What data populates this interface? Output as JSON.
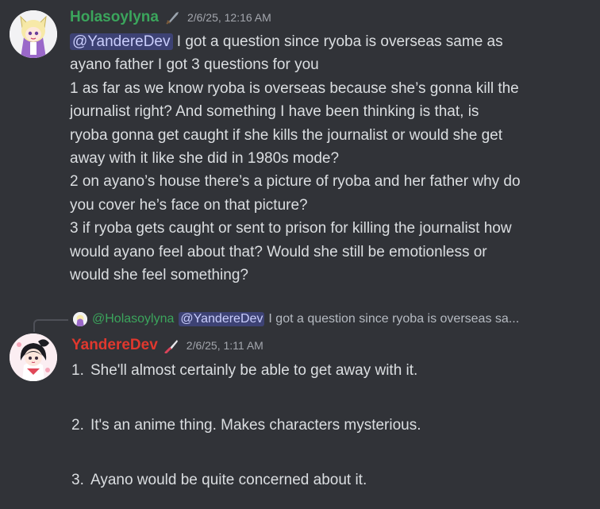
{
  "message1": {
    "username": "Holasoylyna",
    "role_icon": "sword-icon",
    "timestamp": "2/6/25, 12:16 AM",
    "mention": "@YandereDev",
    "first_line_rest": " I got a question since ryoba is overseas same as",
    "lines": [
      "ayano father I got 3 questions for you",
      "1 as far as we know ryoba is overseas because she’s gonna kill the",
      "journalist right? And something I have been thinking is that, is",
      "ryoba gonna get caught if she kills the journalist or would she get",
      "away with it like she did in 1980s mode?",
      "2 on ayano’s house there’s a picture of ryoba and her father why do",
      "you cover he’s face on that picture?",
      "3 if ryoba gets caught or sent to prison for killing the journalist how",
      "would ayano feel about that? Would she still be emotionless or",
      "would she feel something?"
    ]
  },
  "reply": {
    "username": "@Holasoylyna",
    "mention": "@YandereDev",
    "text": "I got a question since ryoba is overseas sa..."
  },
  "message2": {
    "username": "YandereDev",
    "role_icon": "knife-icon",
    "timestamp": "2/6/25, 1:11 AM",
    "items": [
      {
        "num": "1.",
        "text": "She'll almost certainly be able to get away with it."
      },
      {
        "num": "2.",
        "text": "It's an anime thing. Makes characters mysterious."
      },
      {
        "num": "3.",
        "text": "Ayano would be quite concerned about it."
      }
    ]
  },
  "colors": {
    "background": "#313338",
    "user1": "#3ba55c",
    "user2": "#e0382e",
    "mention_bg": "#5865f2"
  }
}
